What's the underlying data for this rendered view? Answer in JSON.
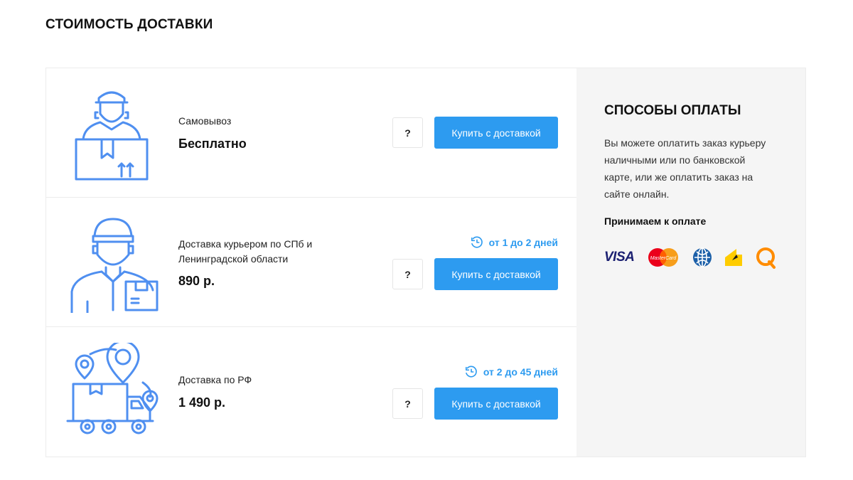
{
  "page": {
    "title": "СТОИМОСТЬ ДОСТАВКИ"
  },
  "delivery": {
    "help_label": "?",
    "buy_label": "Купить с доставкой",
    "options": [
      {
        "icon": "pickup-person-box-icon",
        "name": "Самовывоз",
        "price": "Бесплатно",
        "term": ""
      },
      {
        "icon": "courier-icon",
        "name": "Доставка курьером по СПб и Ленинградской области",
        "price": "890 р.",
        "term": "от 1 до 2 дней"
      },
      {
        "icon": "delivery-truck-map-icon",
        "name": "Доставка по РФ",
        "price": "1 490 р.",
        "term": "от 2 до 45 дней"
      }
    ]
  },
  "payment": {
    "title": "СПОСОБЫ ОПЛАТЫ",
    "text": "Вы можете оплатить заказ курьеру наличными или по банковской карте, или же оплатить заказ на сайте онлайн.",
    "accept_label": "Принимаем к оплате",
    "logos": [
      "visa-logo",
      "mastercard-logo",
      "webmoney-logo",
      "yandex-money-logo",
      "qiwi-logo"
    ],
    "visa_text": "VISA",
    "mastercard_text": "MasterCard"
  },
  "colors": {
    "accent": "#2d9bf0",
    "icon": "#4f8ff0",
    "panel": "#f5f5f5"
  }
}
